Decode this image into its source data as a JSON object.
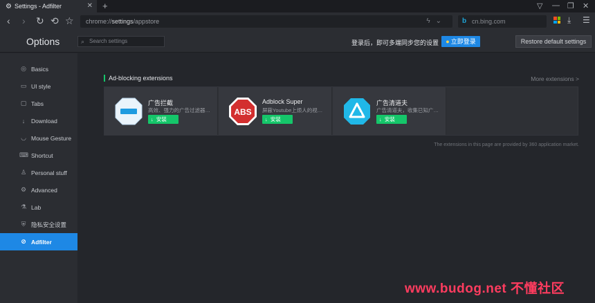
{
  "browser": {
    "tab_title": "Settings - Adfilter",
    "new_tab": "+",
    "url_scheme": "chrome://",
    "url_host": "settings",
    "url_path": "/appstore",
    "search_engine_text": "cn.bing.com"
  },
  "options": {
    "title": "Options",
    "search_placeholder": "Search settings",
    "login_hint": "登录后，即可多端同步您的设置",
    "login_button": "立即登录",
    "restore_button": "Restore default settings"
  },
  "sidebar": {
    "items": [
      {
        "label": "Basics",
        "icon": "settings-circle-icon",
        "glyph": "◎"
      },
      {
        "label": "UI style",
        "icon": "window-icon",
        "glyph": "▭"
      },
      {
        "label": "Tabs",
        "icon": "tabs-icon",
        "glyph": "▢"
      },
      {
        "label": "Download",
        "icon": "download-icon",
        "glyph": "↓"
      },
      {
        "label": "Mouse Gesture",
        "icon": "mouse-icon",
        "glyph": "◡"
      },
      {
        "label": "Shortcut",
        "icon": "keyboard-icon",
        "glyph": "⌨"
      },
      {
        "label": "Personal stuff",
        "icon": "user-icon",
        "glyph": "♙"
      },
      {
        "label": "Advanced",
        "icon": "wrench-icon",
        "glyph": "⚙"
      },
      {
        "label": "Lab",
        "icon": "flask-icon",
        "glyph": "⚗"
      },
      {
        "label": "隐私安全设置",
        "icon": "shield-icon",
        "glyph": "⛨"
      },
      {
        "label": "Adfilter",
        "icon": "block-icon",
        "glyph": "⊘",
        "active": true
      }
    ]
  },
  "main": {
    "section_title": "Ad-blocking extensions",
    "more_link": "More extensions >",
    "extensions": [
      {
        "name": "广告拦截",
        "desc": "高效、强力的广告过滤器…",
        "install": "安装",
        "icon": "ad-block-minus-icon"
      },
      {
        "name": "Adblock Super",
        "desc": "屏蔽Youtube上烦人的视…",
        "install": "安装",
        "icon": "abs-stop-sign-icon"
      },
      {
        "name": "广告清道夫",
        "desc": "广告清道夫，收集已知广…",
        "install": "安装",
        "icon": "triangle-logo-icon"
      }
    ],
    "footnote": "The extensions in this page are provided by 360 application market."
  },
  "watermark": "www.budog.net 不懂社区",
  "colors": {
    "accent": "#1e88e5",
    "install_green": "#15c66a",
    "watermark": "#ff3c5f"
  }
}
